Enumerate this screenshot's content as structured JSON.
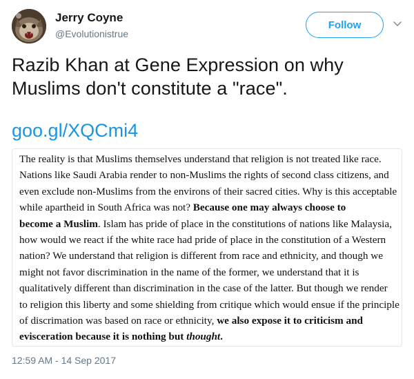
{
  "author": {
    "display_name": "Jerry Coyne",
    "handle": "@Evolutionistrue"
  },
  "follow_button": {
    "label": "Follow"
  },
  "icons": {
    "menu": "chevron-down-icon",
    "avatar": "avatar-cat-image"
  },
  "tweet": {
    "text": "Razib Khan at Gene Expression on why Muslims don't constitute a \"race\".",
    "link": "goo.gl/XQCmi4",
    "timestamp": "12:59 AM - 14 Sep 2017"
  },
  "quote": {
    "lines": [
      [
        {
          "t": "The reality is that Muslims themselves understand that religion is not treated like race."
        }
      ],
      [
        {
          "t": "Nations like Saudi Arabia render to non-Muslims the rights of second class citizens, and"
        }
      ],
      [
        {
          "t": "even exclude non-Muslims from the environs of their sacred cities. Why is this acceptable"
        }
      ],
      [
        {
          "t": "while apartheid in South Africa was not? "
        },
        {
          "t": "Because one may always choose to",
          "b": true
        }
      ],
      [
        {
          "t": "become a Muslim",
          "b": true
        },
        {
          "t": ". Islam has pride of place in the constitutions of nations like Malaysia,"
        }
      ],
      [
        {
          "t": "how would we react if the white race had pride of place in the constitution of a Western"
        }
      ],
      [
        {
          "t": "nation? We understand that religion is different from race and ethnicity, and though we"
        }
      ],
      [
        {
          "t": "might not favor discrimination in the name of the former, we understand that it is"
        }
      ],
      [
        {
          "t": "qualitatively different than discrimination in the case of the latter. But though we render"
        }
      ],
      [
        {
          "t": "to religion this liberty and some shielding from critique which would ensue if the principle"
        }
      ],
      [
        {
          "t": "of discrimation was based on race or ethnicity, "
        },
        {
          "t": "we also expose it to criticism and",
          "b": true
        }
      ],
      [
        {
          "t": "evisceration because it is nothing but ",
          "b": true
        },
        {
          "t": "thought",
          "b": true,
          "i": true
        },
        {
          "t": ".",
          "b": true
        }
      ]
    ]
  },
  "colors": {
    "accent": "#1da1f2",
    "link": "#1b95e0",
    "secondary_text": "#657786",
    "primary_text": "#14171a",
    "card_border": "#e1e8ed"
  }
}
